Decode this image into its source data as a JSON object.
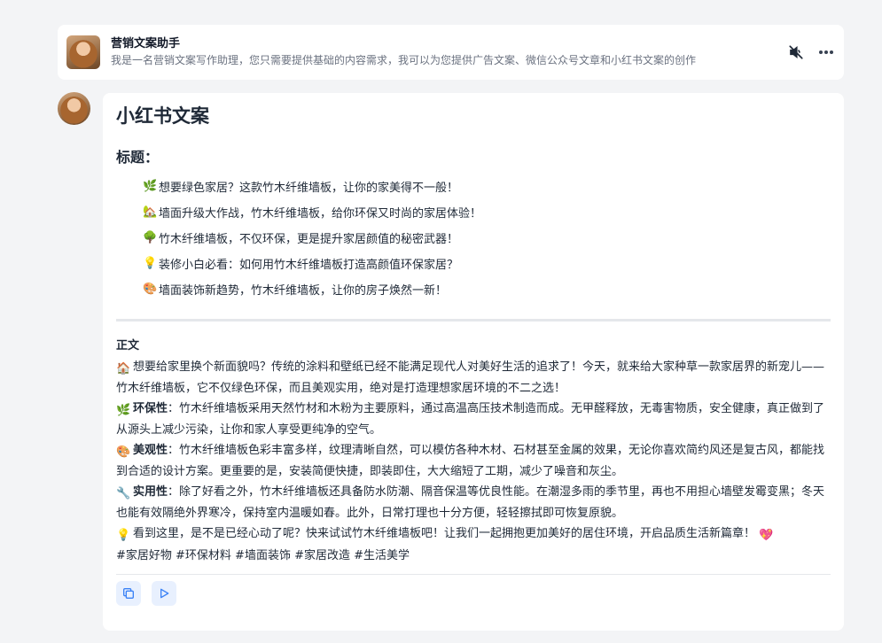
{
  "header": {
    "title": "营销文案助手",
    "description": "我是一名营销文案写作助理，您只需要提供基础的内容需求，我可以为您提供广告文案、微信公众号文章和小红书文案的创作",
    "mute_icon": "speaker-muted-icon",
    "more_icon": "more-horizontal-icon"
  },
  "message": {
    "heading": "小红书文案",
    "subheading": "标题：",
    "headlines": [
      {
        "emoji": "🌿",
        "text": "想要绿色家居？这款竹木纤维墙板，让你的家美得不一般！"
      },
      {
        "emoji": "🏡",
        "text": "墙面升级大作战，竹木纤维墙板，给你环保又时尚的家居体验！"
      },
      {
        "emoji": "🌳",
        "text": "竹木纤维墙板，不仅环保，更是提升家居颜值的秘密武器！"
      },
      {
        "emoji": "💡",
        "text": "装修小白必看：如何用竹木纤维墙板打造高颜值环保家居？"
      },
      {
        "emoji": "🎨",
        "text": "墙面装饰新趋势，竹木纤维墙板，让你的房子焕然一新！"
      }
    ],
    "body_title": "正文",
    "para1": {
      "emoji": "🏠",
      "text": "想要给家里换个新面貌吗？传统的涂料和壁纸已经不能满足现代人对美好生活的追求了！今天，就来给大家种草一款家居界的新宠儿——竹木纤维墙板，它不仅绿色环保，而且美观实用，绝对是打造理想家居环境的不二之选！"
    },
    "para2": {
      "emoji": "🌿",
      "label": "环保性",
      "text": "：竹木纤维墙板采用天然竹材和木粉为主要原料，通过高温高压技术制造而成。无甲醛释放，无毒害物质，安全健康，真正做到了从源头上减少污染，让你和家人享受更纯净的空气。"
    },
    "para3": {
      "emoji": "🎨",
      "label": "美观性",
      "text": "：竹木纤维墙板色彩丰富多样，纹理清晰自然，可以模仿各种木材、石材甚至金属的效果，无论你喜欢简约风还是复古风，都能找到合适的设计方案。更重要的是，安装简便快捷，即装即住，大大缩短了工期，减少了噪音和灰尘。"
    },
    "para4": {
      "emoji": "🔧",
      "label": "实用性",
      "text": "：除了好看之外，竹木纤维墙板还具备防水防潮、隔音保温等优良性能。在潮湿多雨的季节里，再也不用担心墙壁发霉变黑；冬天也能有效隔绝外界寒冷，保持室内温暖如春。此外，日常打理也十分方便，轻轻擦拭即可恢复原貌。"
    },
    "para5": {
      "emoji": "💡",
      "text": "看到这里，是不是已经心动了呢？快来试试竹木纤维墙板吧！让我们一起拥抱更加美好的居住环境，开启品质生活新篇章！",
      "end_emoji": "💖"
    },
    "hashtags": "#家居好物 #环保材料 #墙面装饰 #家居改造 #生活美学"
  },
  "actions": {
    "copy_icon": "copy-icon",
    "play_icon": "play-icon"
  },
  "colors": {
    "accent": "#3b82f6",
    "background": "#f3f4f6",
    "card": "#ffffff"
  }
}
